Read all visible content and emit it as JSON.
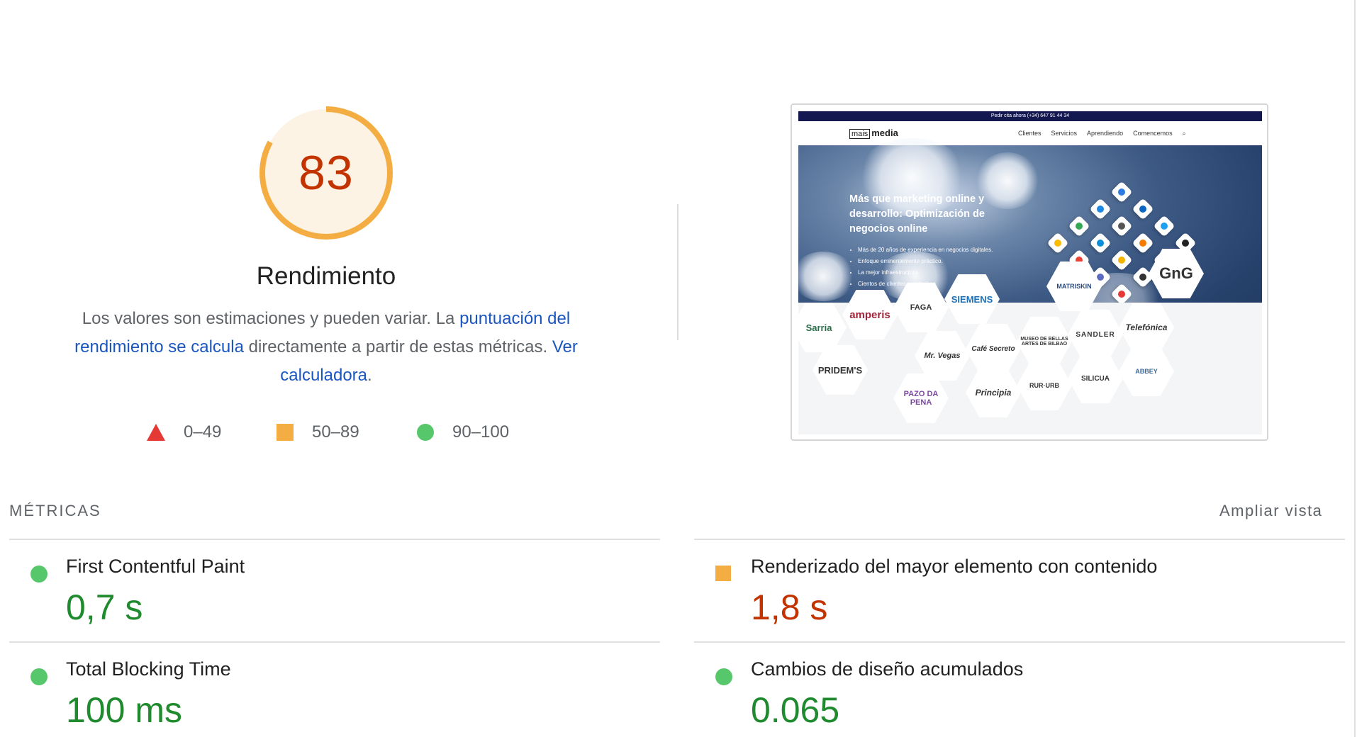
{
  "summary": {
    "score": "83",
    "score_fraction": 0.83,
    "score_color": "#f4ad42",
    "title": "Rendimiento",
    "desc_part1": "Los valores son estimaciones y pueden variar. La ",
    "desc_link1": "puntuación del rendimiento se calcula",
    "desc_part2": " directamente a partir de estas métricas. ",
    "desc_link2": "Ver calculadora",
    "desc_end": "."
  },
  "legend": [
    {
      "shape": "triangle-icon",
      "label": "0–49",
      "color": "#e53935"
    },
    {
      "shape": "square-icon",
      "label": "50–89",
      "color": "#f4ad42"
    },
    {
      "shape": "circle-icon",
      "label": "90–100",
      "color": "#57c76b"
    }
  ],
  "thumbnail": {
    "topbar": "Pedir cita ahora (+34) 647 91 44 34",
    "logo_box": "mais",
    "logo_text": "media",
    "menu": [
      "Clientes",
      "Servicios",
      "Aprendiendo",
      "Comencemos"
    ],
    "headline": "Más que marketing online y desarrollo: Optimización de negocios online",
    "bullets": [
      "Más de 20 años de experiencia en negocios digitales.",
      "Enfoque eminentemente práctico.",
      "La mejor infraestructura.",
      "Cientos de clientes satisfechos"
    ],
    "brands": [
      "Sarria",
      "amperis",
      "FAGA",
      "SIEMENS",
      "MATRISKIN",
      "GnG",
      "PRIDEM'S",
      "Mr. Vegas",
      "Café Secreto",
      "MUSEO DE BELLAS ARTES DE BILBAO",
      "SANDLER",
      "Telefónica",
      "PAZO DA PENA",
      "Principia",
      "RUR·URB",
      "SILICUA",
      "ABBEY"
    ]
  },
  "metrics": {
    "heading": "MÉTRICAS",
    "toggle": "Ampliar vista",
    "items": [
      {
        "label": "First Contentful Paint",
        "value": "0,7 s",
        "rating": "good"
      },
      {
        "label": "Renderizado del mayor elemento con contenido",
        "value": "1,8 s",
        "rating": "average"
      },
      {
        "label": "Total Blocking Time",
        "value": "100 ms",
        "rating": "good"
      },
      {
        "label": "Cambios de diseño acumulados",
        "value": "0.065",
        "rating": "good"
      }
    ]
  },
  "colors": {
    "good": "#1f8a2e",
    "average": "#c33300",
    "link": "#1a56c0",
    "gauge_bg": "#fdf3e5"
  }
}
